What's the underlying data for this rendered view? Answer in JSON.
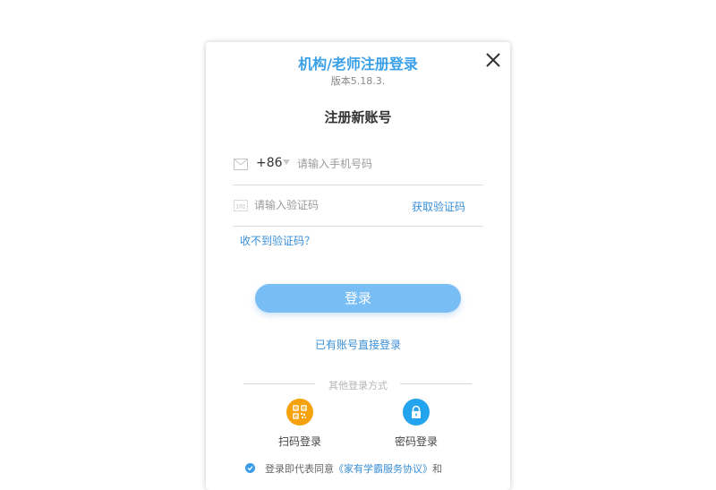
{
  "dialog": {
    "title": "机构/老师注册登录",
    "version": "版本5.18.3.",
    "heading": "注册新账号"
  },
  "phone": {
    "country_code": "+86",
    "placeholder": "请输入手机号码",
    "value": ""
  },
  "code": {
    "placeholder": "请输入验证码",
    "value": "",
    "get_code_label": "获取验证码"
  },
  "no_code_link": "收不到验证码？",
  "login_button": "登录",
  "existing_account_link": "已有账号直接登录",
  "other_methods": {
    "label": "其他登录方式",
    "options": [
      {
        "label": "扫码登录",
        "icon": "qr-code-icon",
        "color": "#f5a20d"
      },
      {
        "label": "密码登录",
        "icon": "lock-icon",
        "color": "#24a4ee"
      }
    ]
  },
  "agreement": {
    "checked": true,
    "prefix": "登录即代表同意",
    "link": "《家有学霸服务协议》",
    "suffix": "和"
  },
  "colors": {
    "accent": "#3aa0e8",
    "link": "#3a8fd6",
    "button": "#79bdf5"
  }
}
